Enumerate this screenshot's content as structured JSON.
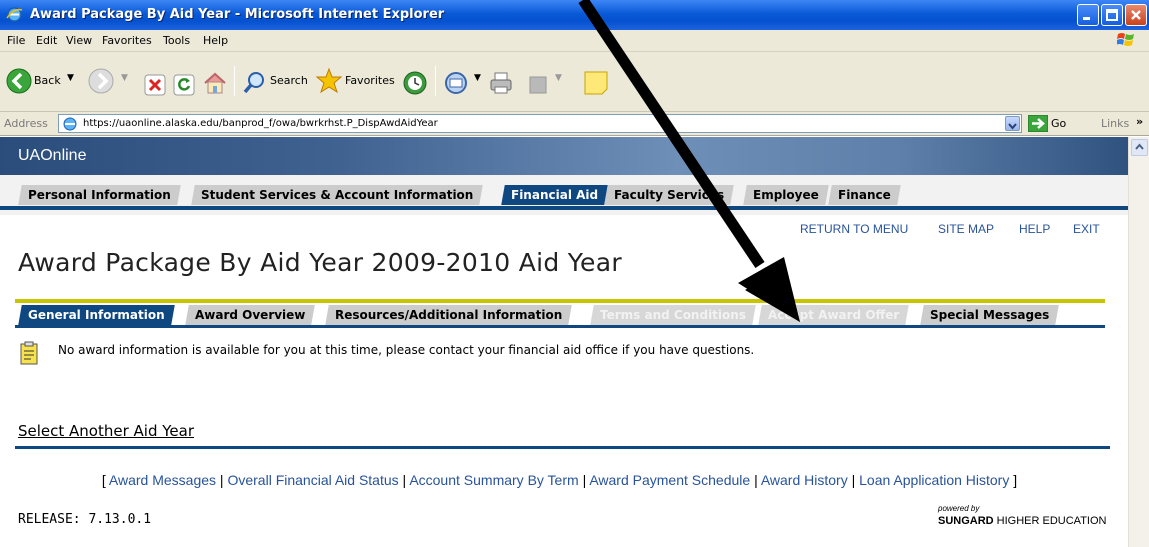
{
  "window": {
    "title": "Award Package By Aid Year - Microsoft Internet Explorer"
  },
  "menu": [
    "File",
    "Edit",
    "View",
    "Favorites",
    "Tools",
    "Help"
  ],
  "toolbar": {
    "back": "Back",
    "search": "Search",
    "favorites": "Favorites"
  },
  "address": {
    "label": "Address",
    "url": "https://uaonline.alaska.edu/banprod_f/owa/bwrkrhst.P_DispAwdAidYear",
    "go": "Go",
    "links": "Links"
  },
  "site": {
    "brand": "UAOnline"
  },
  "nav_tabs": [
    {
      "label": "Personal Information",
      "state": "normal"
    },
    {
      "label": "Student Services & Account Information",
      "state": "normal"
    },
    {
      "label": "Financial Aid",
      "state": "active"
    },
    {
      "label": "Faculty Services",
      "state": "normal"
    },
    {
      "label": "Employee",
      "state": "normal"
    },
    {
      "label": "Finance",
      "state": "normal"
    }
  ],
  "top_links": [
    "RETURN TO MENU",
    "SITE MAP",
    "HELP",
    "EXIT"
  ],
  "page_title": "Award Package By Aid Year 2009-2010 Aid Year",
  "sub_tabs": [
    {
      "label": "General Information",
      "state": "active"
    },
    {
      "label": "Award Overview",
      "state": "normal"
    },
    {
      "label": "Resources/Additional Information",
      "state": "normal"
    },
    {
      "label": "Terms and Conditions",
      "state": "disabled"
    },
    {
      "label": "Accept Award Offer",
      "state": "disabled"
    },
    {
      "label": "Special Messages",
      "state": "normal"
    }
  ],
  "info_message": "No award information is available for you at this time, please contact your financial aid office if you have questions.",
  "select_another": "Select Another Aid Year",
  "footer": {
    "open_bracket": "[",
    "close_bracket": "]",
    "separator": "|",
    "links": [
      "Award Messages",
      "Overall Financial Aid Status",
      "Account Summary By Term",
      "Award Payment Schedule",
      "Award History",
      "Loan Application History"
    ]
  },
  "release": "RELEASE: 7.13.0.1",
  "powered_by": "powered by",
  "sungard": {
    "bold": "SUNGARD",
    "rest": " HIGHER EDUCATION"
  },
  "colors": {
    "nav_active": "#0f4880",
    "link": "#28539a",
    "olive_rule": "#c7c400",
    "xp_title": "#0a5ad8"
  }
}
